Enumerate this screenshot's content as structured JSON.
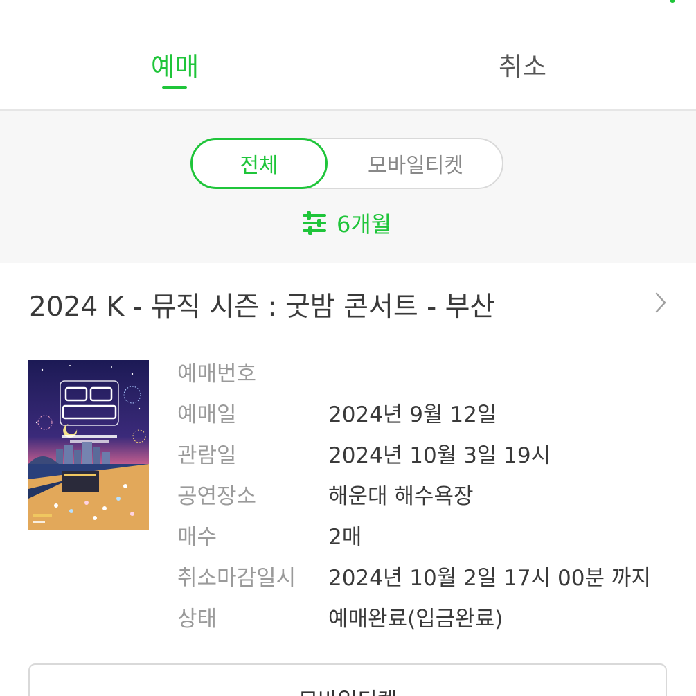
{
  "tabs": {
    "reserve": "예매",
    "cancel": "취소"
  },
  "filter": {
    "all": "전체",
    "mobile_ticket": "모바일티켓",
    "period": "6개월"
  },
  "event": {
    "title": "2024 K - 뮤직 시즌 : 굿밤 콘서트 - 부산"
  },
  "details": [
    {
      "label": "예매번호",
      "value": ""
    },
    {
      "label": "예매일",
      "value": "2024년 9월 12일"
    },
    {
      "label": "관람일",
      "value": "2024년 10월 3일 19시"
    },
    {
      "label": "공연장소",
      "value": "해운대 해수욕장"
    },
    {
      "label": "매수",
      "value": "2매"
    },
    {
      "label": "취소마감일시",
      "value": "2024년 10월 2일 17시 00분 까지"
    },
    {
      "label": "상태",
      "value": "예매완료(입금완료)"
    }
  ],
  "bottom_button": {
    "label": "모바일티켓"
  },
  "colors": {
    "accent": "#1fc53a"
  },
  "icons": {
    "filter": "sliders-icon",
    "chevron": "chevron-right-icon"
  }
}
